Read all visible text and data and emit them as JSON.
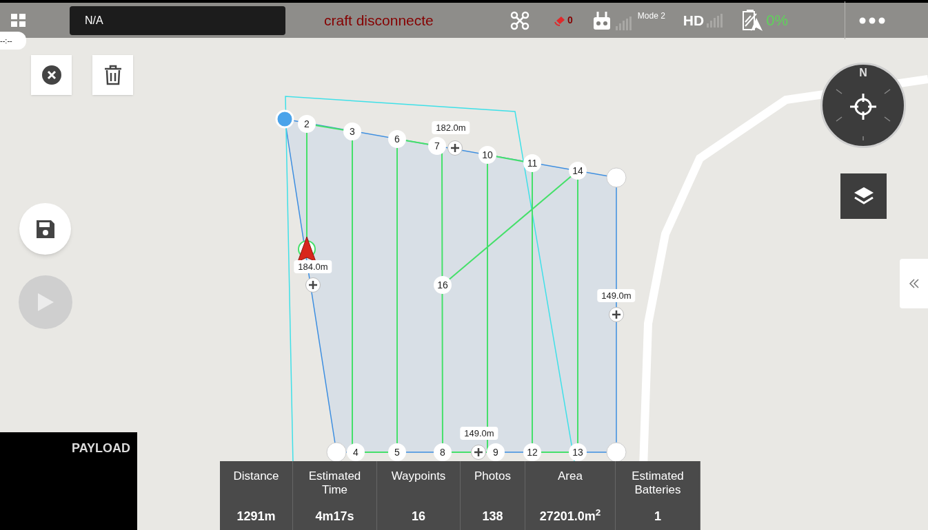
{
  "top_bar": {
    "flight_field": "N/A",
    "status_message": "craft disconnecte",
    "gps_count": "0",
    "rc_mode": "Mode 2",
    "hd_label": "HD",
    "battery": "0%"
  },
  "clock_badge": "--:--",
  "compass_north": "N",
  "waypoints": [
    {
      "label": "2"
    },
    {
      "label": "3"
    },
    {
      "label": "6"
    },
    {
      "label": "7"
    },
    {
      "label": "10"
    },
    {
      "label": "11"
    },
    {
      "label": "14"
    },
    {
      "label": "4"
    },
    {
      "label": "5"
    },
    {
      "label": "8"
    },
    {
      "label": "9"
    },
    {
      "label": "12"
    },
    {
      "label": "13"
    },
    {
      "label": "16"
    }
  ],
  "edge_lengths": [
    "182.0m",
    "184.0m",
    "149.0m",
    "149.0m"
  ],
  "payload_label": "PAYLOAD",
  "stats": [
    {
      "label": "Distance",
      "value": "1291m"
    },
    {
      "label": "Estimated Time",
      "value": "4m17s"
    },
    {
      "label": "Waypoints",
      "value": "16"
    },
    {
      "label": "Photos",
      "value": "138"
    },
    {
      "label": "Area",
      "value": "27201.0m$^{2}$"
    },
    {
      "label": "Estimated Batteries",
      "value": "1"
    }
  ]
}
